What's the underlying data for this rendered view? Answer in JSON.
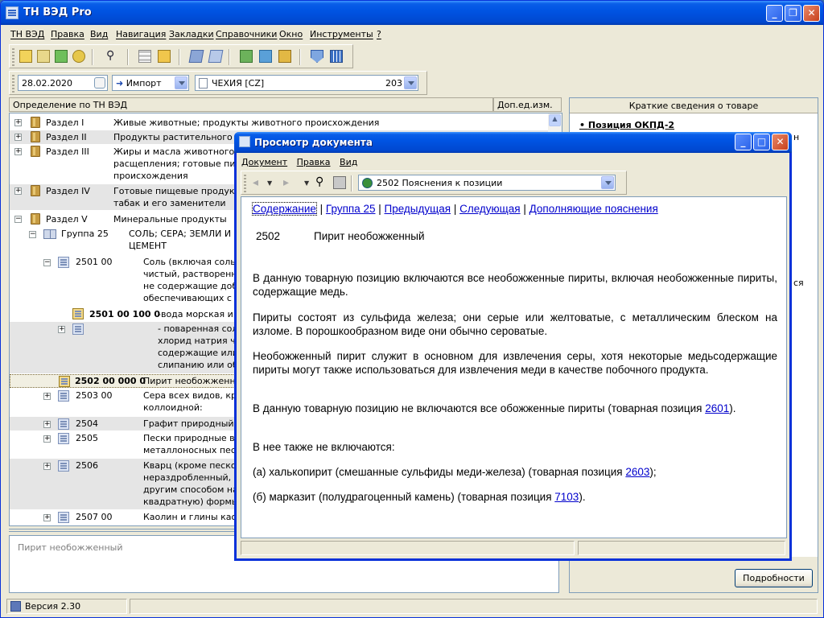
{
  "app": {
    "title": "ТН ВЭД Pro"
  },
  "menu": [
    "ТН ВЭД",
    "Правка",
    "Вид",
    "Навигация",
    "Закладки",
    "Справочники",
    "Окно",
    "Инструменты",
    "?"
  ],
  "filter": {
    "date": "28.02.2020",
    "direction": "Импорт",
    "country": "ЧЕХИЯ [CZ]",
    "country_code": "203"
  },
  "tree": {
    "col_definition": "Определение по ТН ВЭД",
    "col_unit": "Доп.ед.изм.",
    "rows": [
      {
        "code": "Раздел I",
        "text": "Живые животные; продукты животного происхождения"
      },
      {
        "code": "Раздел II",
        "text": "Продукты растительного п"
      },
      {
        "code": "Раздел III",
        "text": "Жиры и масла животного"
      },
      {
        "code": "",
        "text": "расщепления; готовые пищ"
      },
      {
        "code": "",
        "text": "происхождения"
      },
      {
        "code": "Раздел IV",
        "text": "Готовые пищевые продукт"
      },
      {
        "code": "",
        "text": "табак и его заменители"
      },
      {
        "code": "Раздел V",
        "text": "Минеральные продукты"
      },
      {
        "code": "Группа 25",
        "text": "СОЛЬ; СЕРА; ЗЕМЛИ И"
      },
      {
        "code": "",
        "text": "ЦЕМЕНТ"
      },
      {
        "code": "2501 00",
        "text": "Соль (включая соль"
      },
      {
        "code": "",
        "text": "чистый, растворенн"
      },
      {
        "code": "",
        "text": "не содержащие доб"
      },
      {
        "code": "",
        "text": "обеспечивающих с"
      },
      {
        "code": "2501 00 100 0",
        "text": "-вода морская и"
      },
      {
        "code": "",
        "text": "- поваренная сол"
      },
      {
        "code": "",
        "text": "хлорид натрия ч"
      },
      {
        "code": "",
        "text": "содержащие или"
      },
      {
        "code": "",
        "text": "слипанию или об"
      },
      {
        "code": "2502 00 000 0",
        "text": "Пирит необожженн"
      },
      {
        "code": "2503 00",
        "text": "Сера всех видов, кр"
      },
      {
        "code": "",
        "text": "коллоидной:"
      },
      {
        "code": "2504",
        "text": "Графит природный:"
      },
      {
        "code": "2505",
        "text": "Пески природные в"
      },
      {
        "code": "",
        "text": "металлоносных пес"
      },
      {
        "code": "2506",
        "text": "Кварц (кроме песко"
      },
      {
        "code": "",
        "text": "нераздробленный,"
      },
      {
        "code": "",
        "text": "другим способом на"
      },
      {
        "code": "",
        "text": "квадратную) формы"
      },
      {
        "code": "2507 00",
        "text": "Каолин и глины као"
      }
    ]
  },
  "selected_text": "Пирит необожженный",
  "right_panel": {
    "title": "Краткие сведения о товаре",
    "item": "Позиция ОКПД-2",
    "frag1": "н",
    "frag2": "ся",
    "details_button": "Подробности"
  },
  "status": {
    "version": "Версия 2.30"
  },
  "dialog": {
    "title": "Просмотр документа",
    "menu": [
      "Документ",
      "Правка",
      "Вид"
    ],
    "address": "2502 Пояснения к позиции",
    "links": [
      "Содержание",
      "Группа 25",
      "Предыдущая",
      "Следующая",
      "Дополняющие пояснения"
    ],
    "heading_code": "2502",
    "heading_text": "Пирит необожженный",
    "p1": "В данную товарную позицию включаются все необожженные пириты, включая необожженные пириты, содержащие медь.",
    "p2": "Пириты состоят из сульфида железа; они серые или желтоватые, с металлическим блеском на изломе. В порошкообразном виде они обычно сероватые.",
    "p3": "Необожженный пирит служит в основном для извлечения серы, хотя некоторые медьсодержащие пириты могут также использоваться для извлечения меди в качестве побочного продукта.",
    "p4_pre": "В данную товарную позицию не включаются все обожженные пириты (товарная позиция ",
    "p4_link": "2601",
    "p4_post": ").",
    "p5": "В нее также не включаются:",
    "p6_pre": "(а) халькопирит (смешанные сульфиды меди-железа) (товарная позиция ",
    "p6_link": "2603",
    "p6_post": ");",
    "p7_pre": "(б) марказит (полудрагоценный камень) (товарная позиция ",
    "p7_link": "7103",
    "p7_post": ")."
  }
}
